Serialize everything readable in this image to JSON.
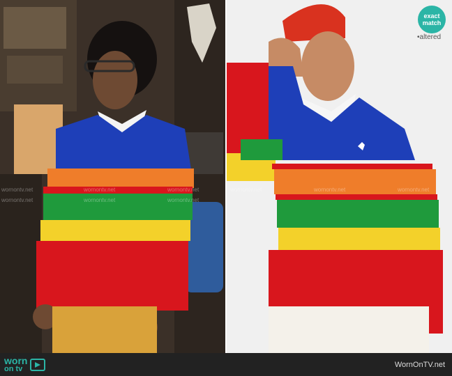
{
  "badge": {
    "line1": "exact",
    "line2": "match",
    "caption": "•altered"
  },
  "watermark": "wornontv.net",
  "footer": {
    "logo_top": "worn",
    "logo_bottom": "on tv",
    "site": "WornOnTV.net"
  },
  "colors": {
    "stripe_blue": "#1e3fb8",
    "stripe_orange": "#ef7d2a",
    "stripe_green": "#1f9a3c",
    "stripe_yellow": "#f3d12a",
    "stripe_red": "#d8161d",
    "accent": "#2bb5a6"
  }
}
